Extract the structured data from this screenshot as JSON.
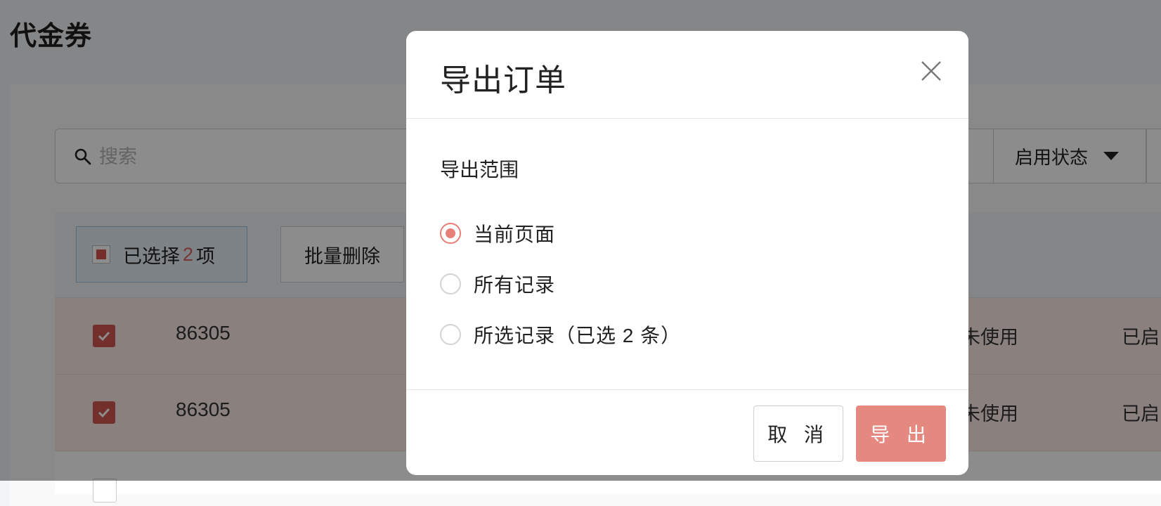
{
  "page": {
    "title": "代金券"
  },
  "search": {
    "placeholder": "搜索"
  },
  "filters": {
    "status_label": "启用状态"
  },
  "toolbar": {
    "selected_prefix": "已选择",
    "selected_count": "2",
    "selected_suffix": "项",
    "batch_delete": "批量删除"
  },
  "rows": [
    {
      "id": "86305",
      "status": "未使用",
      "enabled": "已启"
    },
    {
      "id": "86305",
      "status": "未使用",
      "enabled": "已启"
    }
  ],
  "modal": {
    "title": "导出订单",
    "section_label": "导出范围",
    "options": [
      {
        "label": "当前页面",
        "checked": true
      },
      {
        "label": "所有记录",
        "checked": false
      },
      {
        "label": "所选记录（已选 2 条）",
        "checked": false
      }
    ],
    "cancel_label": "取 消",
    "export_label": "导 出"
  },
  "colors": {
    "accent": "#e57f77",
    "primary_button": "#e58880",
    "row_selected": "#fbe9e6",
    "check": "#d0564f"
  }
}
